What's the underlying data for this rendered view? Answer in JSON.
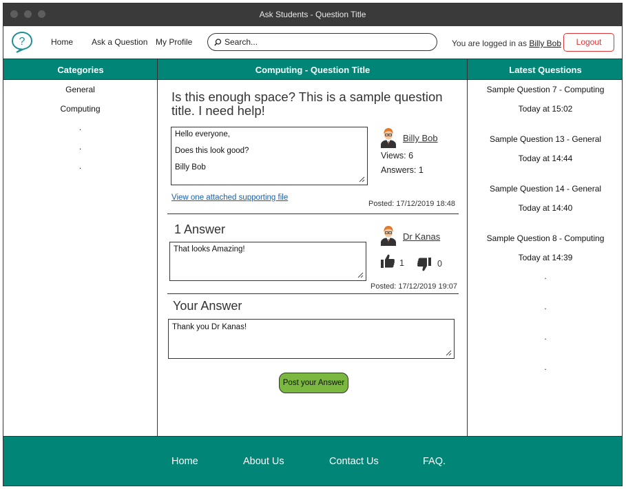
{
  "window": {
    "title": "Ask Students - Question Title"
  },
  "nav": {
    "home": "Home",
    "ask": "Ask a Question",
    "profile": "My Profile",
    "search_placeholder": "Search...",
    "logged_prefix": "You are logged in as",
    "logged_user": "Billy Bob",
    "logout": "Logout"
  },
  "columns": {
    "categories": "Categories",
    "main": "Computing - Question Title",
    "latest": "Latest Questions"
  },
  "categories": [
    "General",
    "Computing",
    ".",
    ".",
    "."
  ],
  "latest": [
    {
      "title": "Sample Question 7 - Computing",
      "time": "Today at 15:02"
    },
    {
      "title": "Sample Question 13 - General",
      "time": "Today at 14:44"
    },
    {
      "title": "Sample Question 14 - General",
      "time": "Today at 14:40"
    },
    {
      "title": "Sample Question 8 - Computing",
      "time": "Today at 14:39"
    }
  ],
  "latest_dots": [
    ".",
    ".",
    ".",
    "."
  ],
  "question": {
    "title": "Is this enough space? This is a sample question title. I need help!",
    "body": [
      "Hello everyone,",
      "Does this look good?",
      "Billy Bob"
    ],
    "author": "Billy Bob",
    "views": "Views: 6",
    "answers": "Answers: 1",
    "attachment": "View one attached supporting file",
    "posted": "Posted: 17/12/2019 18:48"
  },
  "answer": {
    "heading": "1 Answer",
    "body": "That looks Amazing!",
    "author": "Dr Kanas",
    "likes": "1",
    "dislikes": "0",
    "posted": "Posted: 17/12/2019 19:07"
  },
  "your_answer": {
    "heading": "Your Answer",
    "value": "Thank you Dr Kanas!",
    "button": "Post your Answer"
  },
  "footer": {
    "home": "Home",
    "about": "About Us",
    "contact": "Contact Us",
    "faq": "FAQ."
  },
  "colors": {
    "accent": "#008577",
    "logout": "#dd3333",
    "post_button": "#7ab840",
    "link": "#1a5ea8"
  },
  "icons": [
    "question-bubble-logo-icon",
    "search-icon",
    "avatar-icon",
    "thumbs-up-icon",
    "thumbs-down-icon",
    "resize-grip-icon"
  ]
}
